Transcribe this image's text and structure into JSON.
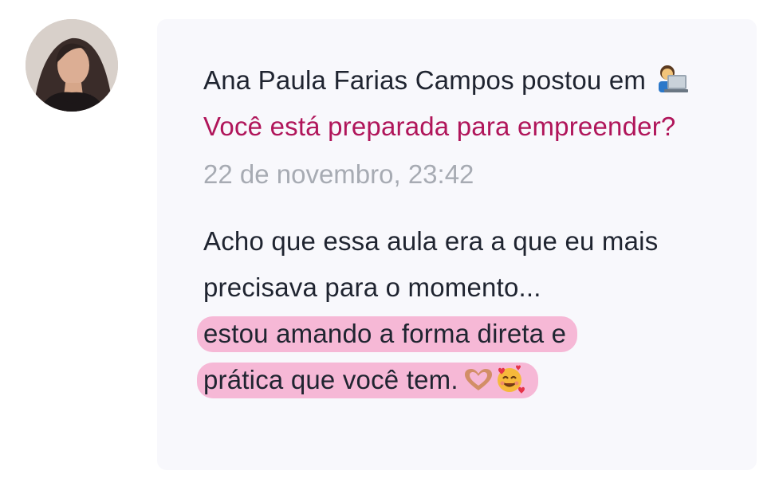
{
  "author": {
    "name": "Ana Paula Farias Campos",
    "posted_in_text": " postou em "
  },
  "post": {
    "title": "Você está preparada para empreender?",
    "timestamp": "22 de novembro, 23:42"
  },
  "comment": {
    "line1": "Acho que essa aula era a que eu mais precisava para o momento...",
    "highlight_a": "estou amando a forma direta e",
    "highlight_b": "prática que você tem."
  },
  "icons": {
    "title_icon": "laptop-technologist-emoji",
    "trailing": [
      "heart-hands-emoji",
      "smiling-face-with-hearts-emoji"
    ]
  },
  "colors": {
    "link": "#b0155a",
    "highlight": "#f6b8d6",
    "timestamp": "#a7abb3",
    "card_bg": "#f8f8fc"
  }
}
